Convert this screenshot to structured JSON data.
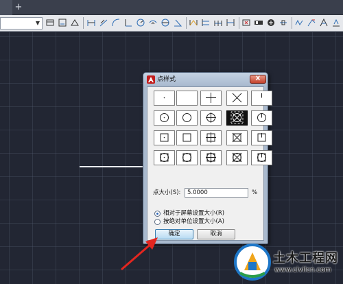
{
  "tabs": {
    "add_label": "+"
  },
  "toolbar": {
    "icons": [
      "layer-props-icon",
      "layer-state-icon",
      "layer-isolate-icon",
      "dim-linear-icon",
      "dim-aligned-icon",
      "dim-arc-icon",
      "dim-ordinate-icon",
      "dim-radius-icon",
      "dim-jogged-icon",
      "dim-diameter-icon",
      "dim-angular-icon",
      "dim-quick-icon",
      "dim-baseline-icon",
      "dim-continue-icon",
      "dim-space-icon",
      "dim-break-icon",
      "tolerance-icon",
      "center-mark-icon",
      "inspect-icon",
      "jogged-linear-icon",
      "dim-edit-icon",
      "dim-text-edit-icon",
      "dim-update-icon",
      "dim-style-icon"
    ]
  },
  "dialog": {
    "title": "点样式",
    "close_label": "X",
    "size_label": "点大小(S):",
    "size_value": "5.0000",
    "size_unit": "%",
    "radio_relative": "相对于屏幕设置大小(R)",
    "radio_absolute": "按绝对单位设置大小(A)",
    "ok_label": "确定",
    "cancel_label": "取消",
    "styles": [
      "dot",
      "none",
      "plus",
      "cross",
      "tick",
      "circle-dot",
      "circle",
      "circle-plus",
      "circle-cross",
      "circle-tick",
      "square-dot",
      "square",
      "square-plus",
      "square-cross",
      "square-tick",
      "circle-square-dot",
      "circle-square",
      "circle-square-plus",
      "circle-square-cross",
      "circle-square-tick"
    ],
    "selected_style": "circle-cross",
    "colors": {
      "title_bg": "#b4c4d8",
      "close_bg": "#c3412b",
      "ok_border": "#3c7fb1"
    }
  },
  "watermark": {
    "title": "土木工程网",
    "url": "www.civilcn.com"
  }
}
